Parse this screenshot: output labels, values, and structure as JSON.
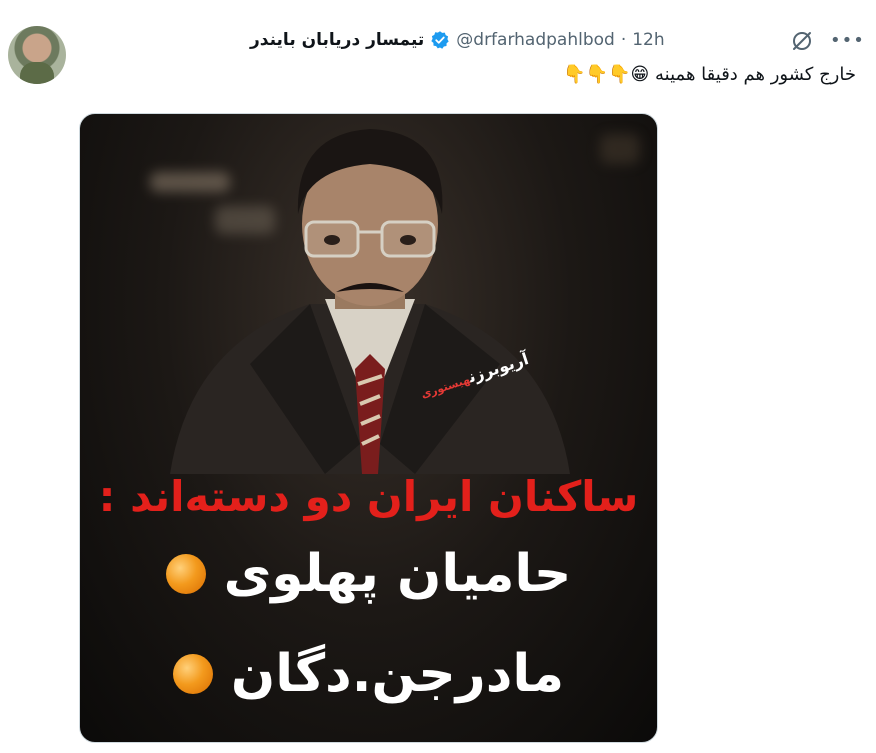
{
  "tweet": {
    "display_name": "تیمسار دریابان بایندر",
    "handle": "@drfarhadpahlbod",
    "separator": "·",
    "time": "12h",
    "text": "خارج کشور هم دقیقا همینه 😁👇👇👇"
  },
  "media": {
    "watermark_name": "آریوبرزن",
    "watermark_sub": "هیستوری",
    "headline": "ساکنان ایران دو دسته‌اند :",
    "option_1": "حامیان پهلوی",
    "option_2": "مادرجن.دگان"
  },
  "icons": {
    "verified": "verified-badge-icon",
    "grok": "grok-icon",
    "more": "more-options-icon"
  },
  "colors": {
    "verified": "#1d9bf0",
    "headline": "#e3201b",
    "bullet": "#f39a1d",
    "secondary_text": "#536471"
  }
}
